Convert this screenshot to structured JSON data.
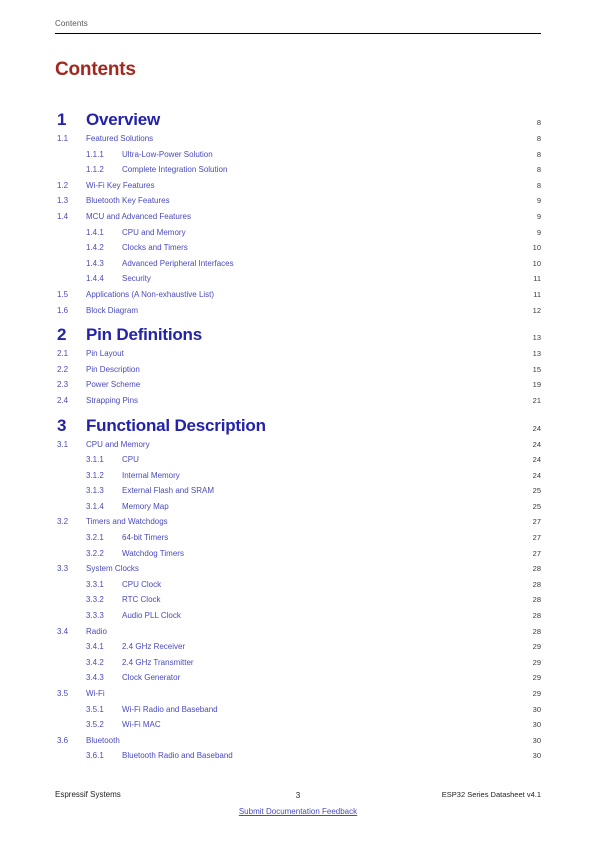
{
  "header": {
    "running_title": "Contents"
  },
  "title": "Contents",
  "toc": {
    "entries": [
      {
        "level": 1,
        "number": "1",
        "label": "Overview",
        "page": "8"
      },
      {
        "level": 2,
        "number": "1.1",
        "label": "Featured Solutions",
        "page": "8"
      },
      {
        "level": 3,
        "number": "1.1.1",
        "label": "Ultra-Low-Power Solution",
        "page": "8"
      },
      {
        "level": 3,
        "number": "1.1.2",
        "label": "Complete Integration Solution",
        "page": "8"
      },
      {
        "level": 2,
        "number": "1.2",
        "label": "Wi-Fi Key Features",
        "page": "8"
      },
      {
        "level": 2,
        "number": "1.3",
        "label": "Bluetooth Key Features",
        "page": "9"
      },
      {
        "level": 2,
        "number": "1.4",
        "label": "MCU and Advanced Features",
        "page": "9"
      },
      {
        "level": 3,
        "number": "1.4.1",
        "label": "CPU and Memory",
        "page": "9"
      },
      {
        "level": 3,
        "number": "1.4.2",
        "label": "Clocks and Timers",
        "page": "10"
      },
      {
        "level": 3,
        "number": "1.4.3",
        "label": "Advanced Peripheral Interfaces",
        "page": "10"
      },
      {
        "level": 3,
        "number": "1.4.4",
        "label": "Security",
        "page": "11"
      },
      {
        "level": 2,
        "number": "1.5",
        "label": "Applications (A Non-exhaustive List)",
        "page": "11"
      },
      {
        "level": 2,
        "number": "1.6",
        "label": "Block Diagram",
        "page": "12"
      },
      {
        "level": 1,
        "number": "2",
        "label": "Pin Definitions",
        "page": "13"
      },
      {
        "level": 2,
        "number": "2.1",
        "label": "Pin Layout",
        "page": "13"
      },
      {
        "level": 2,
        "number": "2.2",
        "label": "Pin Description",
        "page": "15"
      },
      {
        "level": 2,
        "number": "2.3",
        "label": "Power Scheme",
        "page": "19"
      },
      {
        "level": 2,
        "number": "2.4",
        "label": "Strapping Pins",
        "page": "21"
      },
      {
        "level": 1,
        "number": "3",
        "label": "Functional Description",
        "page": "24"
      },
      {
        "level": 2,
        "number": "3.1",
        "label": "CPU and Memory",
        "page": "24"
      },
      {
        "level": 3,
        "number": "3.1.1",
        "label": "CPU",
        "page": "24"
      },
      {
        "level": 3,
        "number": "3.1.2",
        "label": "Internal Memory",
        "page": "24"
      },
      {
        "level": 3,
        "number": "3.1.3",
        "label": "External Flash and SRAM",
        "page": "25"
      },
      {
        "level": 3,
        "number": "3.1.4",
        "label": "Memory Map",
        "page": "25"
      },
      {
        "level": 2,
        "number": "3.2",
        "label": "Timers and Watchdogs",
        "page": "27"
      },
      {
        "level": 3,
        "number": "3.2.1",
        "label": "64-bit Timers",
        "page": "27"
      },
      {
        "level": 3,
        "number": "3.2.2",
        "label": "Watchdog Timers",
        "page": "27"
      },
      {
        "level": 2,
        "number": "3.3",
        "label": "System Clocks",
        "page": "28"
      },
      {
        "level": 3,
        "number": "3.3.1",
        "label": "CPU Clock",
        "page": "28"
      },
      {
        "level": 3,
        "number": "3.3.2",
        "label": "RTC Clock",
        "page": "28"
      },
      {
        "level": 3,
        "number": "3.3.3",
        "label": "Audio PLL Clock",
        "page": "28"
      },
      {
        "level": 2,
        "number": "3.4",
        "label": "Radio",
        "page": "28"
      },
      {
        "level": 3,
        "number": "3.4.1",
        "label": "2.4 GHz Receiver",
        "page": "29"
      },
      {
        "level": 3,
        "number": "3.4.2",
        "label": "2.4 GHz Transmitter",
        "page": "29"
      },
      {
        "level": 3,
        "number": "3.4.3",
        "label": "Clock Generator",
        "page": "29"
      },
      {
        "level": 2,
        "number": "3.5",
        "label": "Wi-Fi",
        "page": "29"
      },
      {
        "level": 3,
        "number": "3.5.1",
        "label": "Wi-Fi Radio and Baseband",
        "page": "30"
      },
      {
        "level": 3,
        "number": "3.5.2",
        "label": "Wi-Fi MAC",
        "page": "30"
      },
      {
        "level": 2,
        "number": "3.6",
        "label": "Bluetooth",
        "page": "30"
      },
      {
        "level": 3,
        "number": "3.6.1",
        "label": "Bluetooth Radio and Baseband",
        "page": "30"
      }
    ]
  },
  "footer": {
    "company": "Espressif Systems",
    "page_number": "3",
    "feedback_link": "Submit Documentation Feedback",
    "document": "ESP32 Series Datasheet v4.1"
  },
  "colors": {
    "title_red": "#A0281E",
    "heading_blue": "#2222AA",
    "entry_blue": "#4A4ABE",
    "page_gray": "#3a3a3a",
    "header_gray": "#555555"
  }
}
